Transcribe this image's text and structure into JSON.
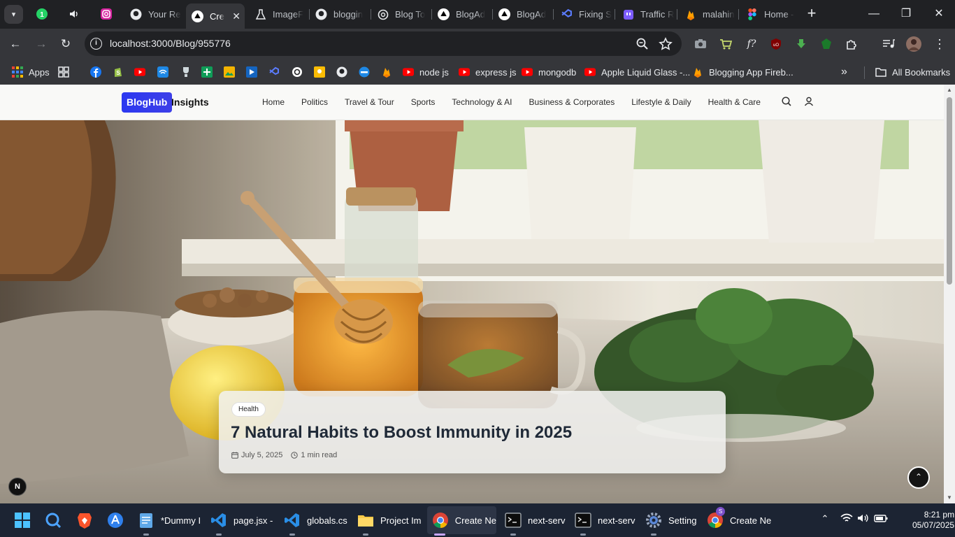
{
  "browser": {
    "tabs": [
      {
        "label": "Your Re",
        "icon": "github-icon"
      },
      {
        "label": "Cre",
        "icon": "vercel-icon",
        "active": true
      },
      {
        "label": "ImageF",
        "icon": "flask-icon"
      },
      {
        "label": "bloggin",
        "icon": "github-icon"
      },
      {
        "label": "Blog To",
        "icon": "openai-icon"
      },
      {
        "label": "BlogAd",
        "icon": "vercel-icon"
      },
      {
        "label": "BlogAd",
        "icon": "vercel-icon"
      },
      {
        "label": "Fixing S",
        "icon": "vscode-icon"
      },
      {
        "label": "Traffic R",
        "icon": "twitch-icon"
      },
      {
        "label": "malahin",
        "icon": "firebase-icon"
      },
      {
        "label": "Home -",
        "icon": "figma-icon"
      }
    ],
    "pinned_badge": "1",
    "url": "localhost:3000/Blog/955776",
    "bookmarks": [
      {
        "label": "Apps",
        "icon": "apps-grid-icon"
      },
      {
        "label": "node js",
        "icon": "youtube-icon"
      },
      {
        "label": "express js",
        "icon": "youtube-icon"
      },
      {
        "label": "mongodb",
        "icon": "youtube-icon"
      },
      {
        "label": "Apple Liquid Glass -...",
        "icon": "youtube-icon"
      },
      {
        "label": "Blogging App Fireb...",
        "icon": "firebase-icon"
      }
    ],
    "all_bookmarks": "All Bookmarks"
  },
  "site": {
    "logo_box": "BlogHub",
    "logo_text": "Insights",
    "menu": [
      "Home",
      "Politics",
      "Travel & Tour",
      "Sports",
      "Technology & AI",
      "Business & Corporates",
      "Lifestyle & Daily",
      "Health & Care"
    ]
  },
  "post": {
    "category": "Health",
    "title": "7 Natural Habits to Boost Immunity in 2025",
    "date": "July 5, 2025",
    "read_time": "1 min read"
  },
  "dev_badge": "N",
  "taskbar": {
    "items": [
      {
        "label": "*Dummy I",
        "icon": "notepad-icon"
      },
      {
        "label": "page.jsx -",
        "icon": "vscode-icon"
      },
      {
        "label": "globals.cs",
        "icon": "vscode-icon"
      },
      {
        "label": "Project Im",
        "icon": "folder-icon"
      },
      {
        "label": "Create Ne",
        "icon": "chrome-icon"
      },
      {
        "label": "next-serv",
        "icon": "terminal-icon"
      },
      {
        "label": "next-serv",
        "icon": "terminal-icon"
      },
      {
        "label": "Setting",
        "icon": "settings-icon"
      },
      {
        "label": "Create Ne",
        "icon": "chrome-icon"
      }
    ],
    "profile_badge": "S",
    "time": "8:21 pm",
    "date": "05/07/2025"
  }
}
